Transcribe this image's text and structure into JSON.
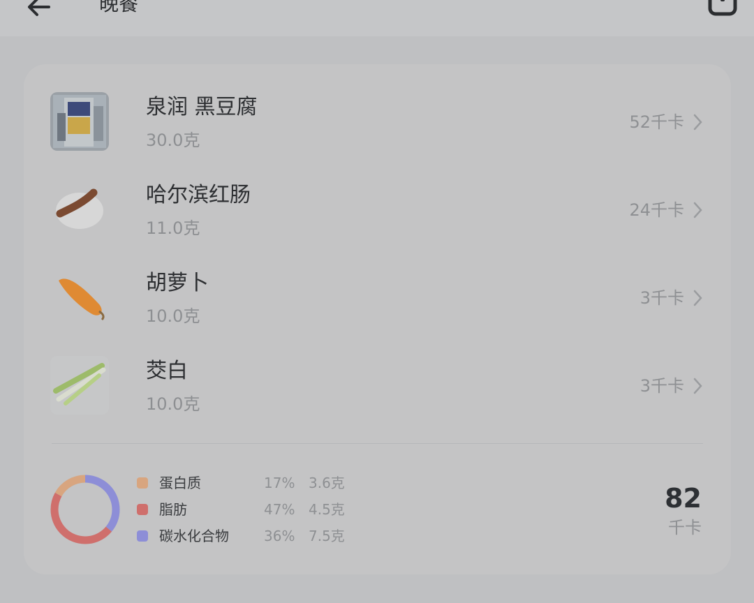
{
  "header": {
    "title": "晚餐"
  },
  "food_list": [
    {
      "name": "泉润 黑豆腐",
      "amount": "30.0克",
      "kcal": "52千卡"
    },
    {
      "name": "哈尔滨红肠",
      "amount": "11.0克",
      "kcal": "24千卡"
    },
    {
      "name": "胡萝卜",
      "amount": "10.0克",
      "kcal": "3千卡"
    },
    {
      "name": "茭白",
      "amount": "10.0克",
      "kcal": "3千卡"
    }
  ],
  "nutrition": {
    "items": [
      {
        "name": "蛋白质",
        "percent": "17%",
        "grams": "3.6克",
        "color": "#d8a57f"
      },
      {
        "name": "脂肪",
        "percent": "47%",
        "grams": "4.5克",
        "color": "#cf6f6c"
      },
      {
        "name": "碳水化合物",
        "percent": "36%",
        "grams": "7.5克",
        "color": "#8d8ed7"
      }
    ],
    "total_value": "82",
    "total_unit": "千卡"
  },
  "colors": {
    "protein": "#d8a57f",
    "fat": "#cf6f6c",
    "carbs": "#8d8ed7"
  }
}
